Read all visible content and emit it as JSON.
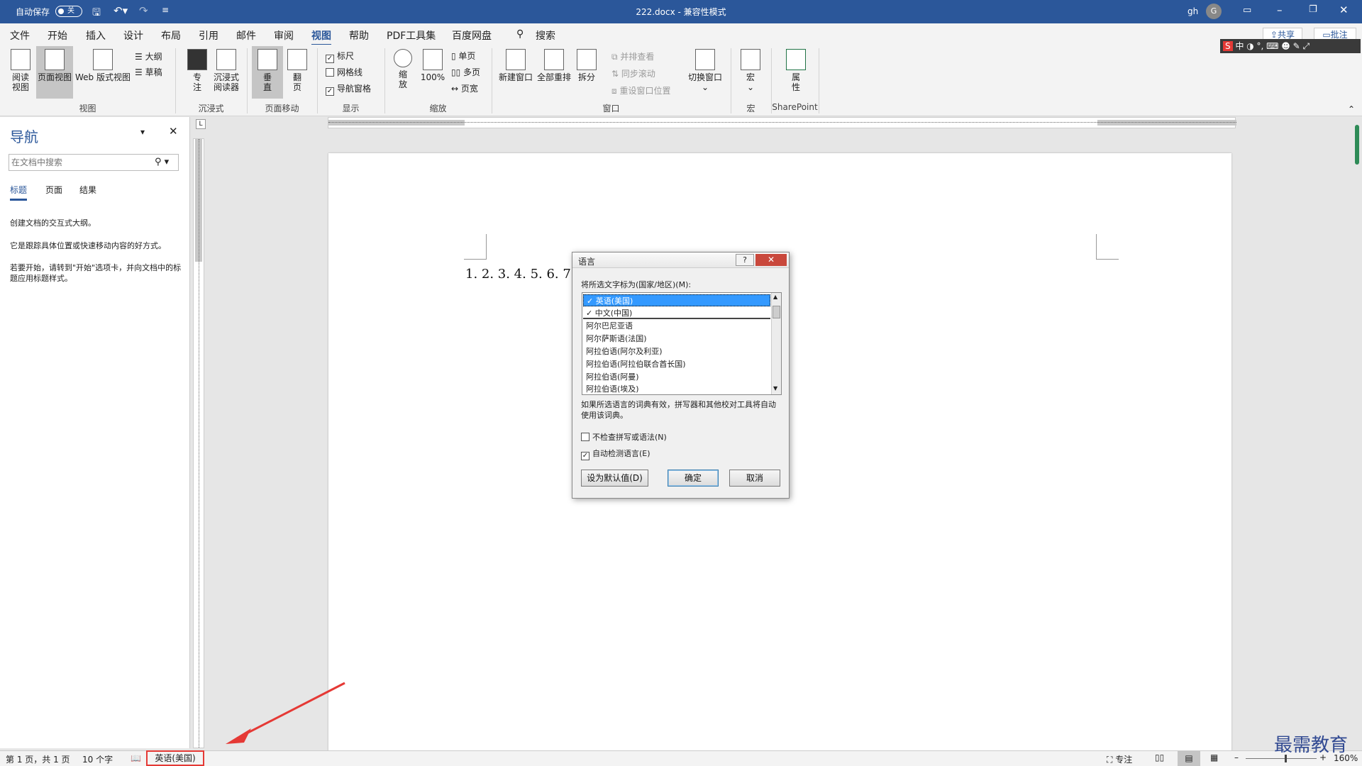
{
  "titlebar": {
    "autosave_label": "自动保存",
    "autosave_state": "关",
    "doc_title": "222.docx  -  兼容性模式",
    "user": "gh",
    "avatar_letter": "G"
  },
  "tabs": [
    "文件",
    "开始",
    "设计",
    "插入",
    "布局",
    "引用",
    "邮件",
    "审阅",
    "视图",
    "帮助",
    "PDF工具集",
    "百度网盘"
  ],
  "tabs_order": [
    "文件",
    "开始",
    "插入",
    "设计",
    "布局",
    "引用",
    "邮件",
    "审阅",
    "视图",
    "帮助",
    "PDF工具集",
    "百度网盘"
  ],
  "search_label": "搜索",
  "share_label": "共享",
  "comment_label": "批注",
  "ribbon": {
    "read_mode": "阅读\n视图",
    "print_layout": "页面视图",
    "web_layout": "Web 版式视图",
    "outline": "大纲",
    "draft": "草稿",
    "group_views": "视图",
    "focus": "专\n注",
    "immersive_reader": "沉浸式\n阅读器",
    "group_immersive": "沉浸式",
    "vertical": "垂\n直",
    "side_to_side": "翻\n页",
    "group_page_movement": "页面移动",
    "ruler": "标尺",
    "gridlines": "网格线",
    "nav_pane": "导航窗格",
    "group_show": "显示",
    "zoom": "缩\n放",
    "zoom_100": "100%",
    "one_page": "单页",
    "multiple_pages": "多页",
    "page_width": "页宽",
    "group_zoom": "缩放",
    "new_window": "新建窗口",
    "arrange_all": "全部重排",
    "split": "拆分",
    "side_by_side": "并排查看",
    "sync_scroll": "同步滚动",
    "reset_position": "重设窗口位置",
    "switch_windows": "切换窗口",
    "group_window": "窗口",
    "macros": "宏",
    "group_macros": "宏",
    "properties": "属\n性",
    "group_sharepoint": "SharePoint"
  },
  "nav": {
    "title": "导航",
    "search_placeholder": "在文档中搜索",
    "tabs": [
      "标题",
      "页面",
      "结果"
    ],
    "msg1": "创建文档的交互式大纲。",
    "msg2": "它是跟踪具体位置或快速移动内容的好方式。",
    "msg3": "若要开始，请转到\"开始\"选项卡，并向文档中的标题应用标题样式。"
  },
  "document": {
    "text": "1. 2. 3. 4. 5. 6. 7."
  },
  "dialog": {
    "title": "语言",
    "prompt": "将所选文字标为(国家/地区)(M):",
    "languages": [
      "英语(美国)",
      "中文(中国)",
      "阿尔巴尼亚语",
      "阿尔萨斯语(法国)",
      "阿拉伯语(阿尔及利亚)",
      "阿拉伯语(阿拉伯联合酋长国)",
      "阿拉伯语(阿曼)",
      "阿拉伯语(埃及)"
    ],
    "note": "如果所选语言的词典有效，拼写器和其他校对工具将自动使用该词典。",
    "no_check": "不检查拼写或语法(N)",
    "auto_detect": "自动检测语言(E)",
    "default_btn": "设为默认值(D)",
    "ok_btn": "确定",
    "cancel_btn": "取消"
  },
  "status": {
    "page": "第 1 页，共 1 页",
    "words": "10 个字",
    "language": "英语(美国)",
    "focus": "专注",
    "zoom": "160%"
  },
  "watermark": "最需教育",
  "colors": {
    "title_blue": "#2b579a",
    "highlight": "#3399ff",
    "annotation_red": "#e53935"
  }
}
